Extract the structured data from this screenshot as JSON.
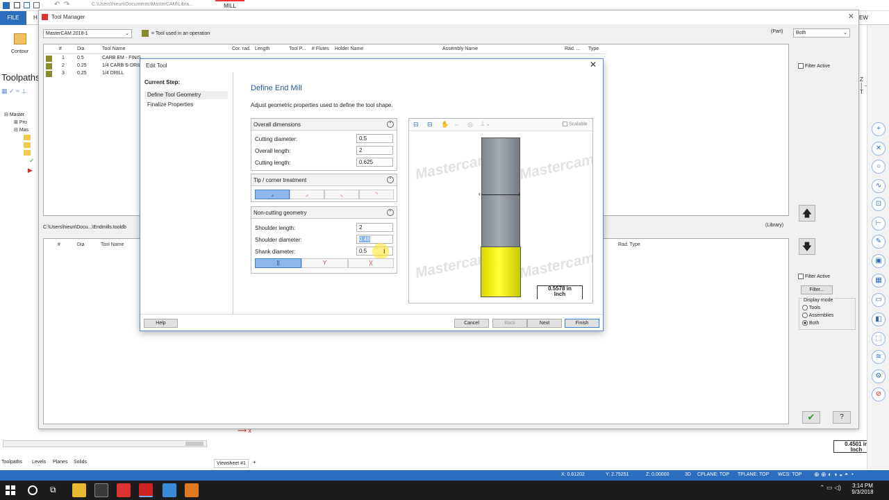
{
  "app": {
    "path_text": "C:\\Users\\hieun\\Documents\\MasterCAM\\Libra...",
    "mill_tab": "MILL",
    "file_tab": "FILE",
    "h_tab": "H",
    "view_tab": "EW"
  },
  "left_panel": {
    "contour_label": "Contour",
    "toolpaths_title": "Toolpaths",
    "tree": [
      "Master",
      "Pro",
      "Mas"
    ],
    "tabs": [
      "Toolpaths",
      "Levels",
      "Planes",
      "Solids"
    ]
  },
  "viewsheet": {
    "tab": "Viewsheet #1",
    "plus": "+"
  },
  "scale_bar": {
    "value": "0.4501 in",
    "unit": "Inch"
  },
  "status": {
    "x": "X:  0.61202",
    "y": "Y:  2.75251",
    "z": "Z:  0.00000",
    "mode": "3D",
    "cplane": "CPLANE: TOP",
    "tplane": "TPLANE: TOP",
    "wcs": "WCS: TOP"
  },
  "taskbar": {
    "time": "3:14 PM",
    "date": "9/3/2018"
  },
  "tool_manager": {
    "title": "Tool Manager",
    "machine_select": "MasterCAM 2018-1",
    "legend": "= Tool used in an operation",
    "part_label": "(Part)",
    "part_select": "Both",
    "library_label": "(Library)",
    "library_path": "C:\\Users\\hieun\\Docu...\\Endmills.tooldb",
    "columns": [
      "#",
      "Dia",
      "Tool Name",
      "Cor. rad.",
      "Length",
      "Tool P...",
      "# Flutes",
      "Holder Name",
      "Assembly Name",
      "Rad. ...",
      "Type"
    ],
    "rows": [
      {
        "num": "1",
        "dia": "0.5",
        "name": "CARB EM - FINIS"
      },
      {
        "num": "2",
        "dia": "0.25",
        "name": "1/4 CARB S-DRIL"
      },
      {
        "num": "3",
        "dia": "0.25",
        "name": "1/4 DRILL"
      }
    ],
    "lib_columns": [
      "#",
      "Dia",
      "Tool Name",
      "Rad. Type"
    ],
    "filter_active_top": "Filter Active",
    "filter_active_bottom": "Filter Active",
    "filter_button": "Filter...",
    "display_mode": {
      "label": "Display mode",
      "options": [
        "Tools",
        "Assemblies",
        "Both"
      ],
      "selected": "Both"
    }
  },
  "edit_tool": {
    "title": "Edit Tool",
    "current_step_label": "Current Step:",
    "steps": [
      "Define Tool Geometry",
      "Finalize Properties"
    ],
    "heading": "Define End Mill",
    "description": "Adjust geometric properties used to define the tool shape.",
    "overall": {
      "title": "Overall dimensions",
      "cutting_diameter_label": "Cutting diameter:",
      "cutting_diameter": "0.5",
      "overall_length_label": "Overall length:",
      "overall_length": "2",
      "cutting_length_label": "Cutting length:",
      "cutting_length": "0.625"
    },
    "tip": {
      "title": "Tip / corner treatment"
    },
    "noncutting": {
      "title": "Non-cutting geometry",
      "shoulder_length_label": "Shoulder length:",
      "shoulder_length": "2",
      "shoulder_diameter_label": "Shoulder diameter:",
      "shoulder_diameter": "0.48",
      "shank_diameter_label": "Shank diameter:",
      "shank_diameter": "0.5"
    },
    "preview": {
      "scalable_label": "Scalable",
      "watermark": "Mastercam",
      "scale_value": "0.5578 in",
      "scale_unit": "Inch"
    },
    "buttons": {
      "help": "Help",
      "cancel": "Cancel",
      "back": "Back",
      "next": "Next",
      "finish": "Finish"
    }
  },
  "colors": {
    "accent": "#2b6ebd",
    "shank": "#8c939c",
    "flute": "#e6e600",
    "highlight": "#fff27a"
  }
}
